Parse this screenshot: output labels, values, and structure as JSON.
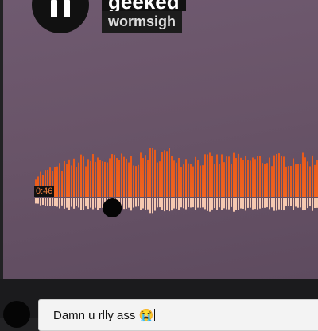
{
  "track": {
    "title": "geeked",
    "artist": "wormsigh",
    "current_time": "0:46",
    "progress": 0.27
  },
  "player": {
    "state_icon": "pause-icon",
    "colors": {
      "played_bar": "#f06420",
      "played_bar_top": "#e85a1a",
      "unplayed_reflection": "#f5c8b0",
      "background": "#695468"
    }
  },
  "comment": {
    "text": "Damn u rlly ass 😭"
  }
}
